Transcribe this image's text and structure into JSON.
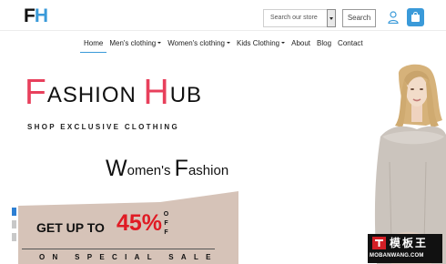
{
  "header": {
    "logo_letters": [
      "F",
      "H"
    ],
    "search_placeholder": "Search our store",
    "search_button": "Search",
    "accent_color": "#3a9ad9"
  },
  "nav": {
    "items": [
      {
        "label": "Home",
        "active": true,
        "dropdown": false
      },
      {
        "label": "Men's clothing",
        "active": false,
        "dropdown": true
      },
      {
        "label": "Women's clothing",
        "active": false,
        "dropdown": true
      },
      {
        "label": "Kids Clothing",
        "active": false,
        "dropdown": true
      },
      {
        "label": "About",
        "active": false,
        "dropdown": false
      },
      {
        "label": "Blog",
        "active": false,
        "dropdown": false
      },
      {
        "label": "Contact",
        "active": false,
        "dropdown": false
      }
    ]
  },
  "hero": {
    "title": {
      "f_initial": "F",
      "f_rest": "ASHION",
      "h_initial": "H",
      "h_rest": "UB"
    },
    "tagline": "SHOP EXCLUSIVE CLOTHING",
    "subtitle": {
      "w_initial": "W",
      "w_rest": "omen's",
      "f_initial": "F",
      "f_rest": "ashion"
    },
    "promo": {
      "text": "GET UP TO",
      "percent": "45%",
      "off_letters": [
        "O",
        "F",
        "F"
      ],
      "special": "ON SPECIAL SALE"
    },
    "slider": {
      "slides": 3,
      "active_index": 0
    },
    "title_accent_color": "#e8405c",
    "percent_color": "#e01b24",
    "promo_panel_color": "#d6c3b8"
  },
  "watermark": {
    "main": "模板王",
    "sub": "MOBANWANG.COM"
  }
}
